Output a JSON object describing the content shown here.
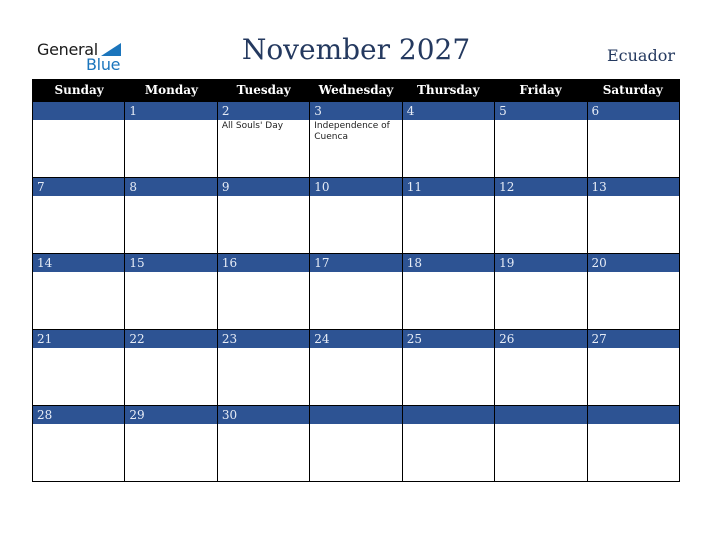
{
  "logo": {
    "line1": "General",
    "line2": "Blue"
  },
  "title": "November 2027",
  "country": "Ecuador",
  "days_of_week": [
    "Sunday",
    "Monday",
    "Tuesday",
    "Wednesday",
    "Thursday",
    "Friday",
    "Saturday"
  ],
  "weeks": [
    {
      "days": [
        {
          "num": "",
          "event": ""
        },
        {
          "num": "1",
          "event": ""
        },
        {
          "num": "2",
          "event": "All Souls' Day"
        },
        {
          "num": "3",
          "event": "Independence of Cuenca"
        },
        {
          "num": "4",
          "event": ""
        },
        {
          "num": "5",
          "event": ""
        },
        {
          "num": "6",
          "event": ""
        }
      ]
    },
    {
      "days": [
        {
          "num": "7",
          "event": ""
        },
        {
          "num": "8",
          "event": ""
        },
        {
          "num": "9",
          "event": ""
        },
        {
          "num": "10",
          "event": ""
        },
        {
          "num": "11",
          "event": ""
        },
        {
          "num": "12",
          "event": ""
        },
        {
          "num": "13",
          "event": ""
        }
      ]
    },
    {
      "days": [
        {
          "num": "14",
          "event": ""
        },
        {
          "num": "15",
          "event": ""
        },
        {
          "num": "16",
          "event": ""
        },
        {
          "num": "17",
          "event": ""
        },
        {
          "num": "18",
          "event": ""
        },
        {
          "num": "19",
          "event": ""
        },
        {
          "num": "20",
          "event": ""
        }
      ]
    },
    {
      "days": [
        {
          "num": "21",
          "event": ""
        },
        {
          "num": "22",
          "event": ""
        },
        {
          "num": "23",
          "event": ""
        },
        {
          "num": "24",
          "event": ""
        },
        {
          "num": "25",
          "event": ""
        },
        {
          "num": "26",
          "event": ""
        },
        {
          "num": "27",
          "event": ""
        }
      ]
    },
    {
      "days": [
        {
          "num": "28",
          "event": ""
        },
        {
          "num": "29",
          "event": ""
        },
        {
          "num": "30",
          "event": ""
        },
        {
          "num": "",
          "event": ""
        },
        {
          "num": "",
          "event": ""
        },
        {
          "num": "",
          "event": ""
        },
        {
          "num": "",
          "event": ""
        }
      ]
    }
  ],
  "colors": {
    "header_bg": "#000000",
    "date_bar": "#2d5393",
    "title": "#24395f",
    "logo_blue": "#1b75bc"
  }
}
